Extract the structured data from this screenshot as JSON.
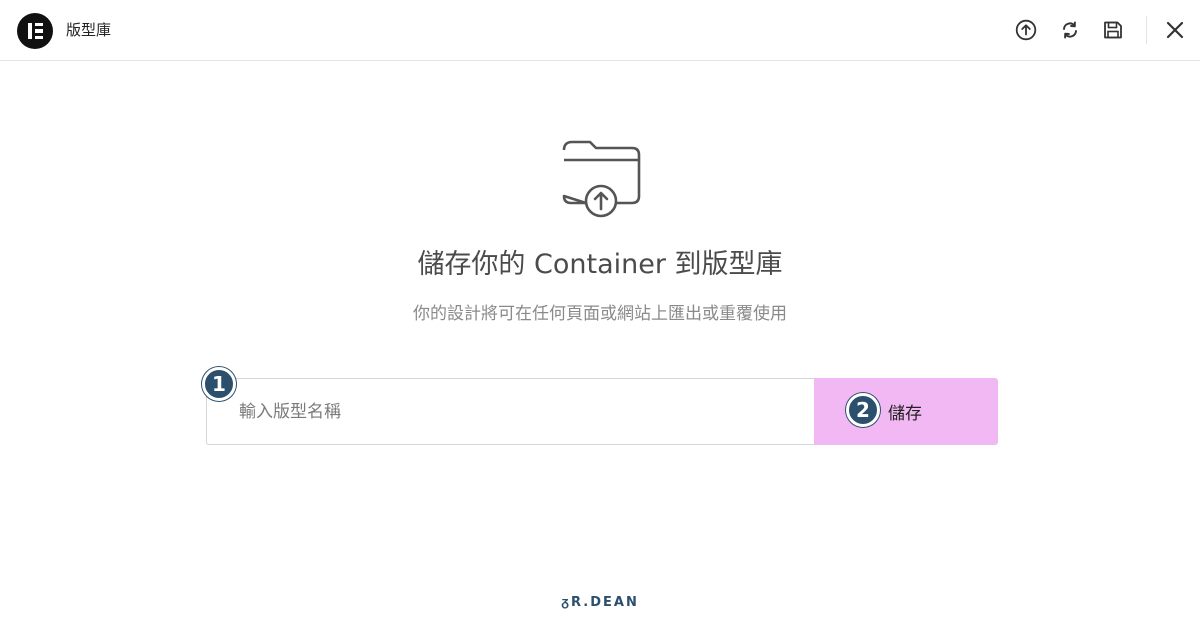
{
  "header": {
    "title": "版型庫",
    "icons": [
      "upload-icon",
      "sync-icon",
      "save-icon",
      "close-icon"
    ]
  },
  "main": {
    "icon": "folder-upload-icon",
    "title": "儲存你的 Container 到版型庫",
    "subtitle": "你的設計將可在任何頁面或網站上匯出或重覆使用",
    "input": {
      "placeholder": "輸入版型名稱",
      "value": ""
    },
    "save_button_label": "儲存"
  },
  "annotations": {
    "step1": "1",
    "step2": "2"
  },
  "watermark": "ᵹR.DEAN",
  "colors": {
    "accent": "#f2b8f3",
    "badge": "#2b4f6c",
    "logo": "#111111"
  }
}
